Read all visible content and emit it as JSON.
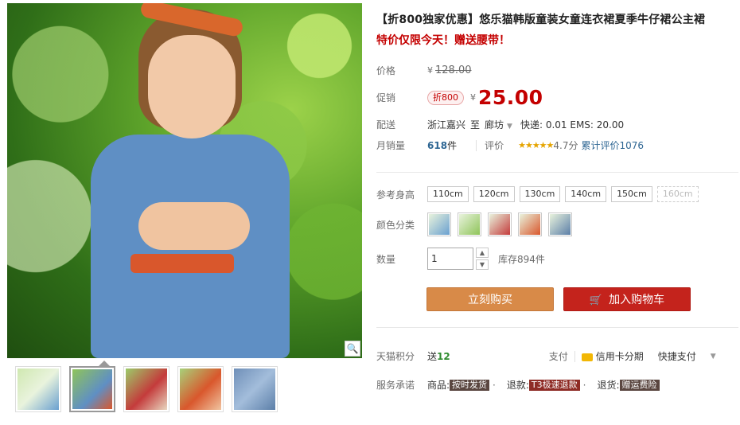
{
  "product": {
    "title_line1": "【折800独家优惠】悠乐猫韩版童装女童连衣裙夏季牛仔裙公主裙",
    "title_line2": "特价仅限今天！赠送腰带！"
  },
  "price": {
    "label": "价格",
    "currency": "¥",
    "original": "128.00"
  },
  "promo": {
    "label": "促销",
    "tag": "折800",
    "currency": "¥",
    "price": "25.00"
  },
  "shipping": {
    "label": "配送",
    "from": "浙江嘉兴",
    "to_word": "至",
    "dest": "廊坊",
    "fees": "快递: 0.01 EMS: 20.00"
  },
  "sales": {
    "label": "月销量",
    "count": "618",
    "unit": "件",
    "review_label": "评价",
    "stars": "★★★★★",
    "score": "4.7分",
    "review_count": "累计评价1076"
  },
  "size": {
    "label": "参考身高",
    "options": [
      "110cm",
      "120cm",
      "130cm",
      "140cm",
      "150cm",
      "160cm"
    ]
  },
  "color": {
    "label": "颜色分类",
    "swatches": [
      "#6aa0d0",
      "#8fc45a",
      "#c43b3b",
      "#d9572c",
      "#5c7fa8"
    ]
  },
  "quantity": {
    "label": "数量",
    "value": "1",
    "stock": "库存894件"
  },
  "buttons": {
    "buy_now": "立刻购买",
    "add_cart": "加入购物车"
  },
  "tmall_points": {
    "label": "天猫积分",
    "prefix": "送",
    "value": "12",
    "pay_label": "支付",
    "credit": "信用卡分期",
    "quick_pay": "快捷支付"
  },
  "service": {
    "label": "服务承诺",
    "goods_label": "商品:",
    "goods_value": "按时发货",
    "refund_label": "退款:",
    "refund_value": "T3极速退款",
    "return_label": "退货:",
    "return_value": "赠运费险"
  }
}
